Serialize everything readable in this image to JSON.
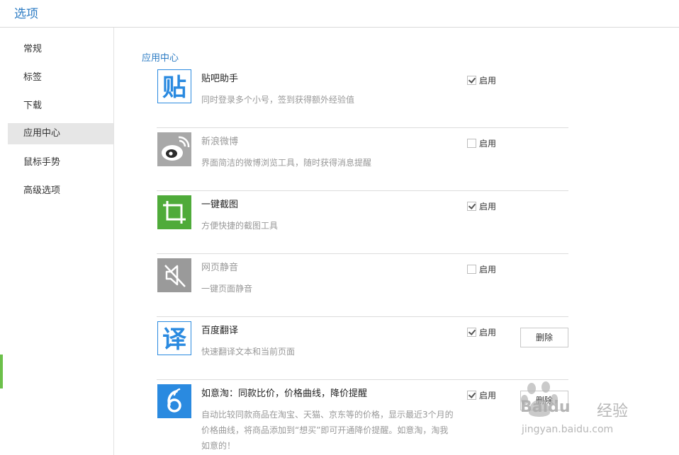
{
  "header": {
    "title": "选项"
  },
  "sidebar": {
    "items": [
      {
        "label": "常规"
      },
      {
        "label": "标签"
      },
      {
        "label": "下载"
      },
      {
        "label": "应用中心"
      },
      {
        "label": "鼠标手势"
      },
      {
        "label": "高级选项"
      }
    ],
    "active_index": 3
  },
  "main": {
    "section_title": "应用中心",
    "enable_label": "启用",
    "delete_label": "删除",
    "apps": [
      {
        "name": "贴吧助手",
        "desc": "同时登录多个小号，签到获得额外经验值",
        "enabled": true,
        "icon": "tieba-icon",
        "icon_text": "贴",
        "color": "#2a8ae0"
      },
      {
        "name": "新浪微博",
        "desc": "界面简洁的微博浏览工具，随时获得消息提醒",
        "enabled": false,
        "icon": "weibo-icon",
        "color": "#9a9a9a"
      },
      {
        "name": "一键截图",
        "desc": "方便快捷的截图工具",
        "enabled": true,
        "icon": "crop-icon",
        "color": "#4fab3a"
      },
      {
        "name": "网页静音",
        "desc": "一键页面静音",
        "enabled": false,
        "icon": "mute-speaker-icon",
        "color": "#9a9a9a"
      },
      {
        "name": "百度翻译",
        "desc": "快速翻译文本和当前页面",
        "enabled": true,
        "icon": "translate-icon",
        "icon_text": "译",
        "color": "#2a8ae0"
      },
      {
        "name": "如意淘：同款比价，价格曲线，降价提醒",
        "desc": "自动比较同款商品在淘宝、天猫、京东等的价格，显示最近3个月的价格曲线，将商品添加到“想买”即可开通降价提醒。如意淘，淘我如意的！",
        "enabled": true,
        "icon": "ruyitao-icon",
        "color": "#2a8ae0"
      }
    ]
  },
  "watermark": {
    "brand": "Baidu",
    "brand_cn": "经验",
    "url": "jingyan.baidu.com"
  }
}
